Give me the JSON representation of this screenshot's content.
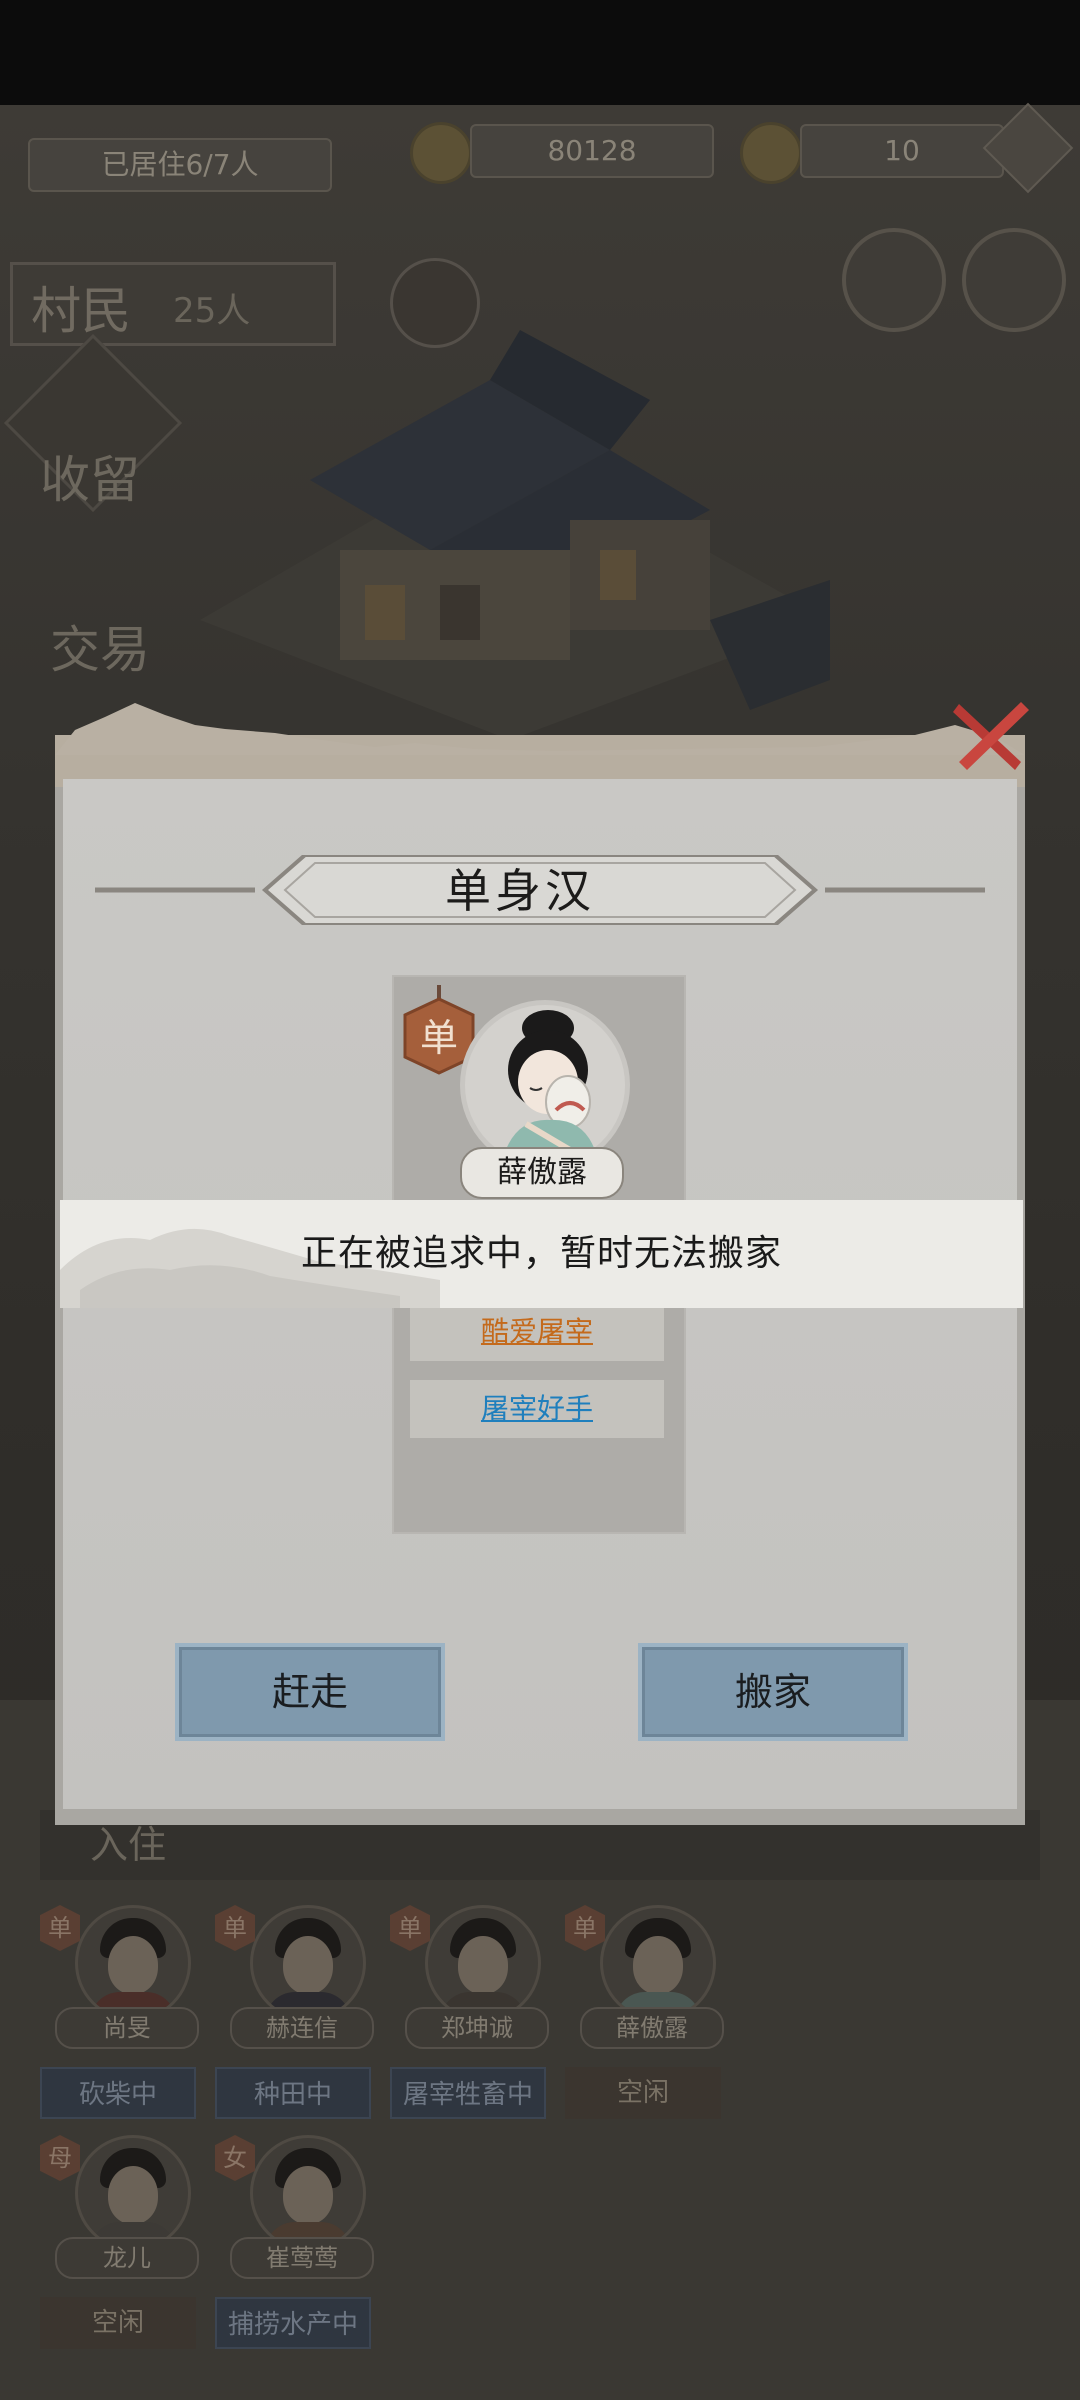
{
  "top_bar": {
    "residents": "已居住6/7人",
    "copper": "80128",
    "gold": "10"
  },
  "sidebar": {
    "villagers_label": "村民",
    "villagers_count": "25人",
    "adopt_label": "收留",
    "trade_label": "交易"
  },
  "modal": {
    "title": "单身汉",
    "tag": "单",
    "character_name": "薛傲露",
    "traits": [
      "酷爱屠宰",
      "屠宰好手"
    ],
    "buttons": {
      "evict": "赶走",
      "move": "搬家"
    }
  },
  "toast": {
    "message": "正在被追求中，暂时无法搬家"
  },
  "residents_list": {
    "header": "入住",
    "villagers": [
      {
        "tag": "单",
        "name": "尚旻",
        "status": "砍柴中",
        "state": "busy"
      },
      {
        "tag": "单",
        "name": "赫连信",
        "status": "种田中",
        "state": "busy"
      },
      {
        "tag": "单",
        "name": "郑坤诚",
        "status": "屠宰牲畜中",
        "state": "busy"
      },
      {
        "tag": "单",
        "name": "薛傲露",
        "status": "空闲",
        "state": "idle"
      },
      {
        "tag": "母",
        "name": "龙儿",
        "status": "空闲",
        "state": "idle"
      },
      {
        "tag": "女",
        "name": "崔莺莺",
        "status": "捕捞水产中",
        "state": "busy"
      }
    ]
  },
  "colors": {
    "button_blue": "#7f99ad",
    "trait_orange": "#c46a1c",
    "trait_blue": "#1f7fbd",
    "close_red": "#b83a35",
    "tag_brown": "#a55f3b"
  }
}
